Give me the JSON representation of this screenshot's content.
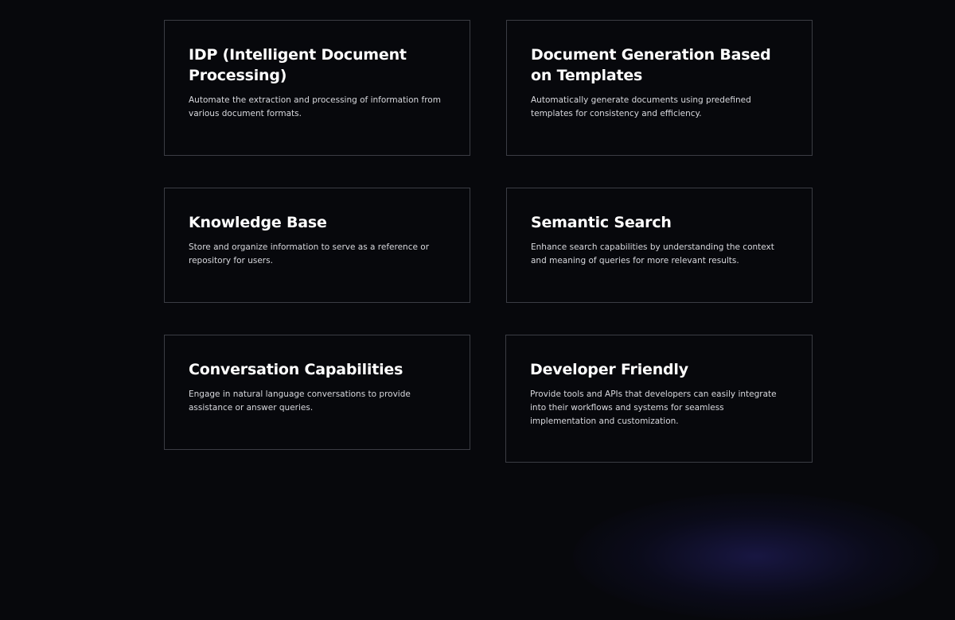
{
  "features": [
    {
      "title": "IDP (Intelligent Document Processing)",
      "description": "Automate the extraction and processing of information from various document formats."
    },
    {
      "title": "Document Generation Based on Templates",
      "description": "Automatically generate documents using predefined templates for consistency and efficiency."
    },
    {
      "title": "Knowledge Base",
      "description": "Store and organize information to serve as a reference or repository for users."
    },
    {
      "title": "Semantic Search",
      "description": "Enhance search capabilities by understanding the context and meaning of queries for more relevant results."
    },
    {
      "title": "Conversation Capabilities",
      "description": "Engage in natural language conversations to provide assistance or answer queries."
    },
    {
      "title": "Developer Friendly",
      "description": "Provide tools and APIs that developers can easily integrate into their workflows and systems for seamless implementation and customization."
    }
  ]
}
